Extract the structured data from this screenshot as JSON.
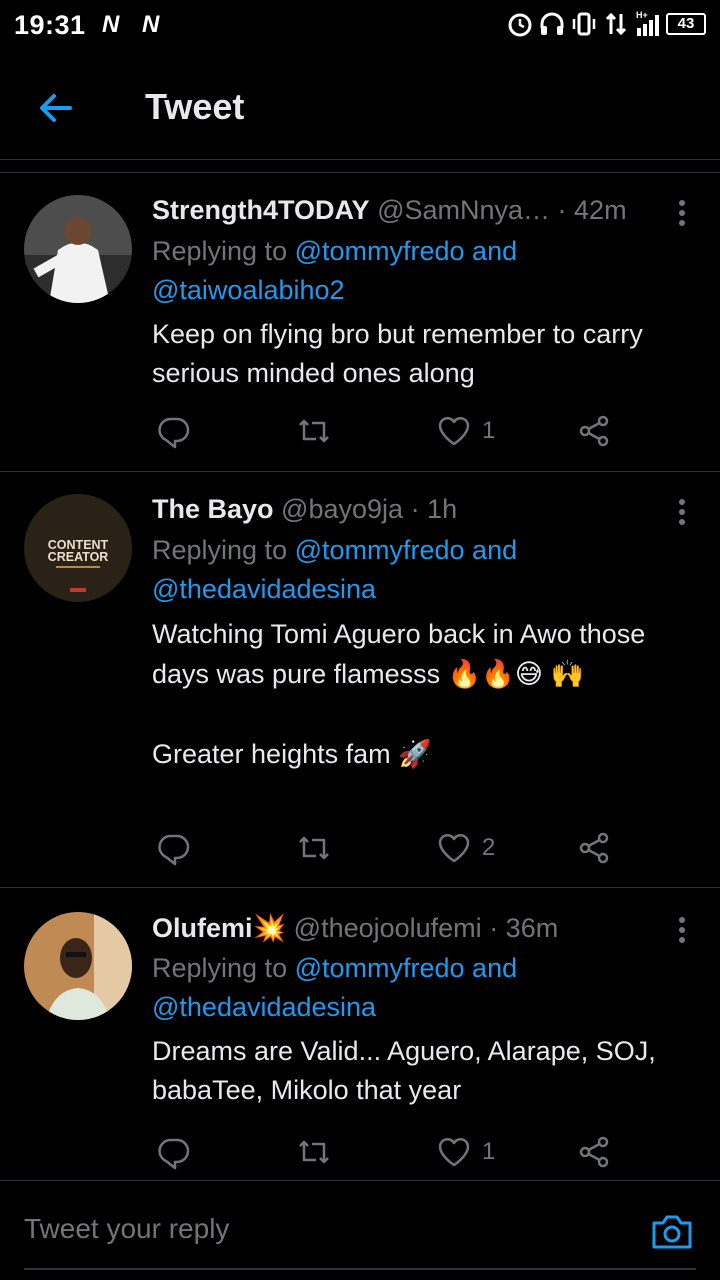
{
  "status_bar": {
    "time": "19:31",
    "carrier_badges": [
      "N",
      "N"
    ],
    "battery": "43",
    "icons": [
      "alarm-icon",
      "headset-icon",
      "vibrate-icon",
      "data-arrows-icon",
      "signal-icon"
    ]
  },
  "header": {
    "title": "Tweet",
    "back_icon": "arrow-left-icon"
  },
  "tweets": [
    {
      "name": "Strength4TODAY",
      "handle": "@SamNnya…",
      "time": "· 42m",
      "replying_prefix": "Replying to",
      "replying_mention1": "@tommyfredo and",
      "replying_mention2": "@taiwoalabiho2",
      "text": "Keep on flying bro but remember to carry serious minded ones along",
      "likes": "1",
      "avatar_colors": [
        "#5a5a5a",
        "#f2f2f2"
      ]
    },
    {
      "name": "The Bayo",
      "handle": "@bayo9ja",
      "time": "· 1h",
      "replying_prefix": "Replying to",
      "replying_mention1": "@tommyfredo and",
      "replying_mention2": "@thedavidadesina",
      "text": "Watching Tomi Aguero back in Awo those days was pure flamesss 🔥🔥😅 🙌\n\nGreater heights fam 🚀",
      "likes": "2",
      "avatar_text_1": "CONTENT",
      "avatar_text_2": "CREATOR",
      "avatar_colors": [
        "#2a2216",
        "#e8e0cc"
      ]
    },
    {
      "name": "Olufemi💥",
      "handle": "@theojoolufemi",
      "time": "· 36m",
      "replying_prefix": "Replying to",
      "replying_mention1": "@tommyfredo and",
      "replying_mention2": "@thedavidadesina",
      "text": "Dreams are Valid... Aguero, Alarape, SOJ, babaTee, Mikolo that year",
      "likes": "1",
      "avatar_colors": [
        "#c08a55",
        "#e8ddd0"
      ]
    }
  ],
  "reply_bar": {
    "placeholder": "Tweet your reply",
    "camera_icon": "camera-icon"
  },
  "colors": {
    "background": "#000000",
    "text": "#e7e9ea",
    "secondary": "#71767b",
    "accent": "#1d9bf0",
    "divider": "#2f3336"
  }
}
